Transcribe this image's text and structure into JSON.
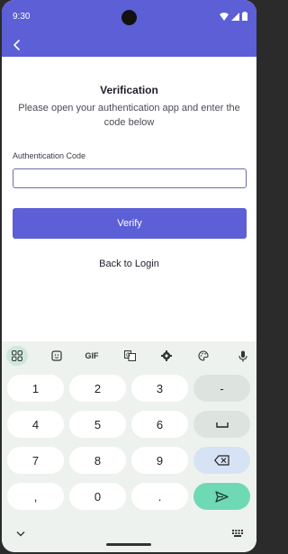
{
  "status": {
    "time": "9:30"
  },
  "icons": {
    "back": "back-arrow-icon",
    "wifi": "wifi-icon",
    "signal": "signal-icon",
    "battery": "battery-icon"
  },
  "colors": {
    "primary": "#5c5fd6",
    "send_key": "#6fd9b6"
  },
  "page": {
    "title": "Verification",
    "subtitle": "Please open your authentication app and enter the code below",
    "field_label": "Authentication Code",
    "field_value": "",
    "verify_label": "Verify",
    "back_to_login": "Back to Login"
  },
  "keyboard": {
    "toolbar": [
      "apps-grid-icon",
      "sticker-icon",
      "GIF",
      "translate-icon",
      "settings-icon",
      "palette-icon",
      "mic-icon"
    ],
    "toolbar_gif": "GIF",
    "keys": {
      "k1": "1",
      "k2": "2",
      "k3": "3",
      "kdash": "-",
      "k4": "4",
      "k5": "5",
      "k6": "6",
      "k7": "7",
      "k8": "8",
      "k9": "9",
      "kcomma": ",",
      "k0": "0",
      "kdot": "."
    }
  }
}
